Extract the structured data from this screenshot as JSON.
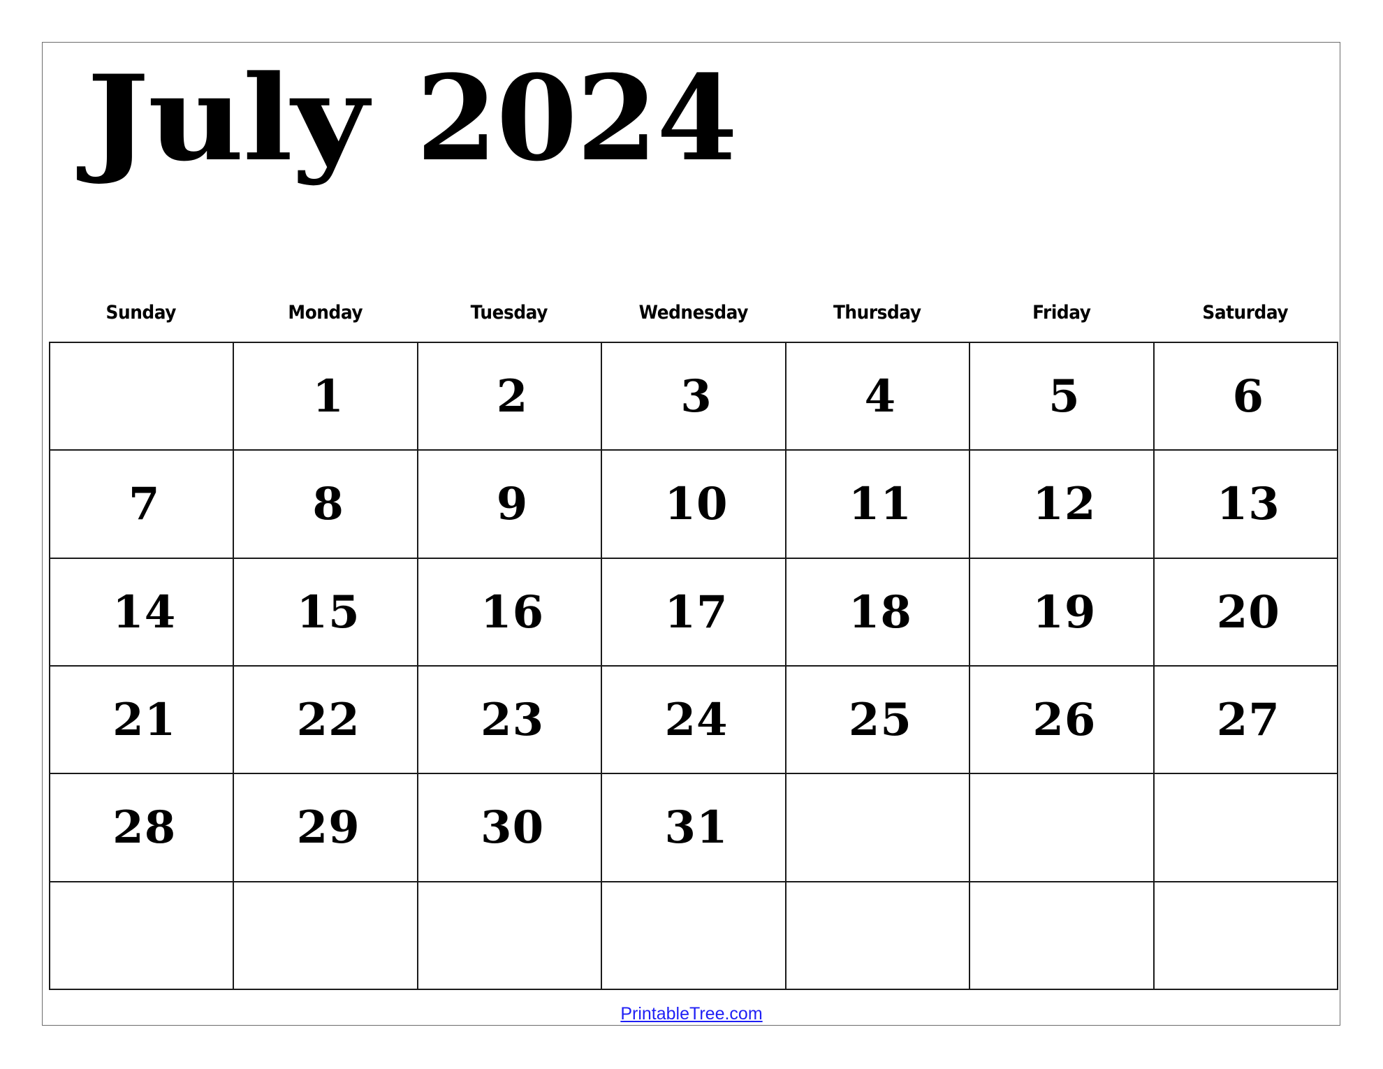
{
  "calendar": {
    "month": "July",
    "year": "2024",
    "weekdays": [
      "Sunday",
      "Monday",
      "Tuesday",
      "Wednesday",
      "Thursday",
      "Friday",
      "Saturday"
    ],
    "weeks": [
      [
        "",
        "1",
        "2",
        "3",
        "4",
        "5",
        "6"
      ],
      [
        "7",
        "8",
        "9",
        "10",
        "11",
        "12",
        "13"
      ],
      [
        "14",
        "15",
        "16",
        "17",
        "18",
        "19",
        "20"
      ],
      [
        "21",
        "22",
        "23",
        "24",
        "25",
        "26",
        "27"
      ],
      [
        "28",
        "29",
        "30",
        "31",
        "",
        "",
        ""
      ],
      [
        "",
        "",
        "",
        "",
        "",
        "",
        ""
      ]
    ]
  },
  "footer": {
    "link_text": "PrintableTree.com",
    "link_color": "#1f1ff5"
  }
}
